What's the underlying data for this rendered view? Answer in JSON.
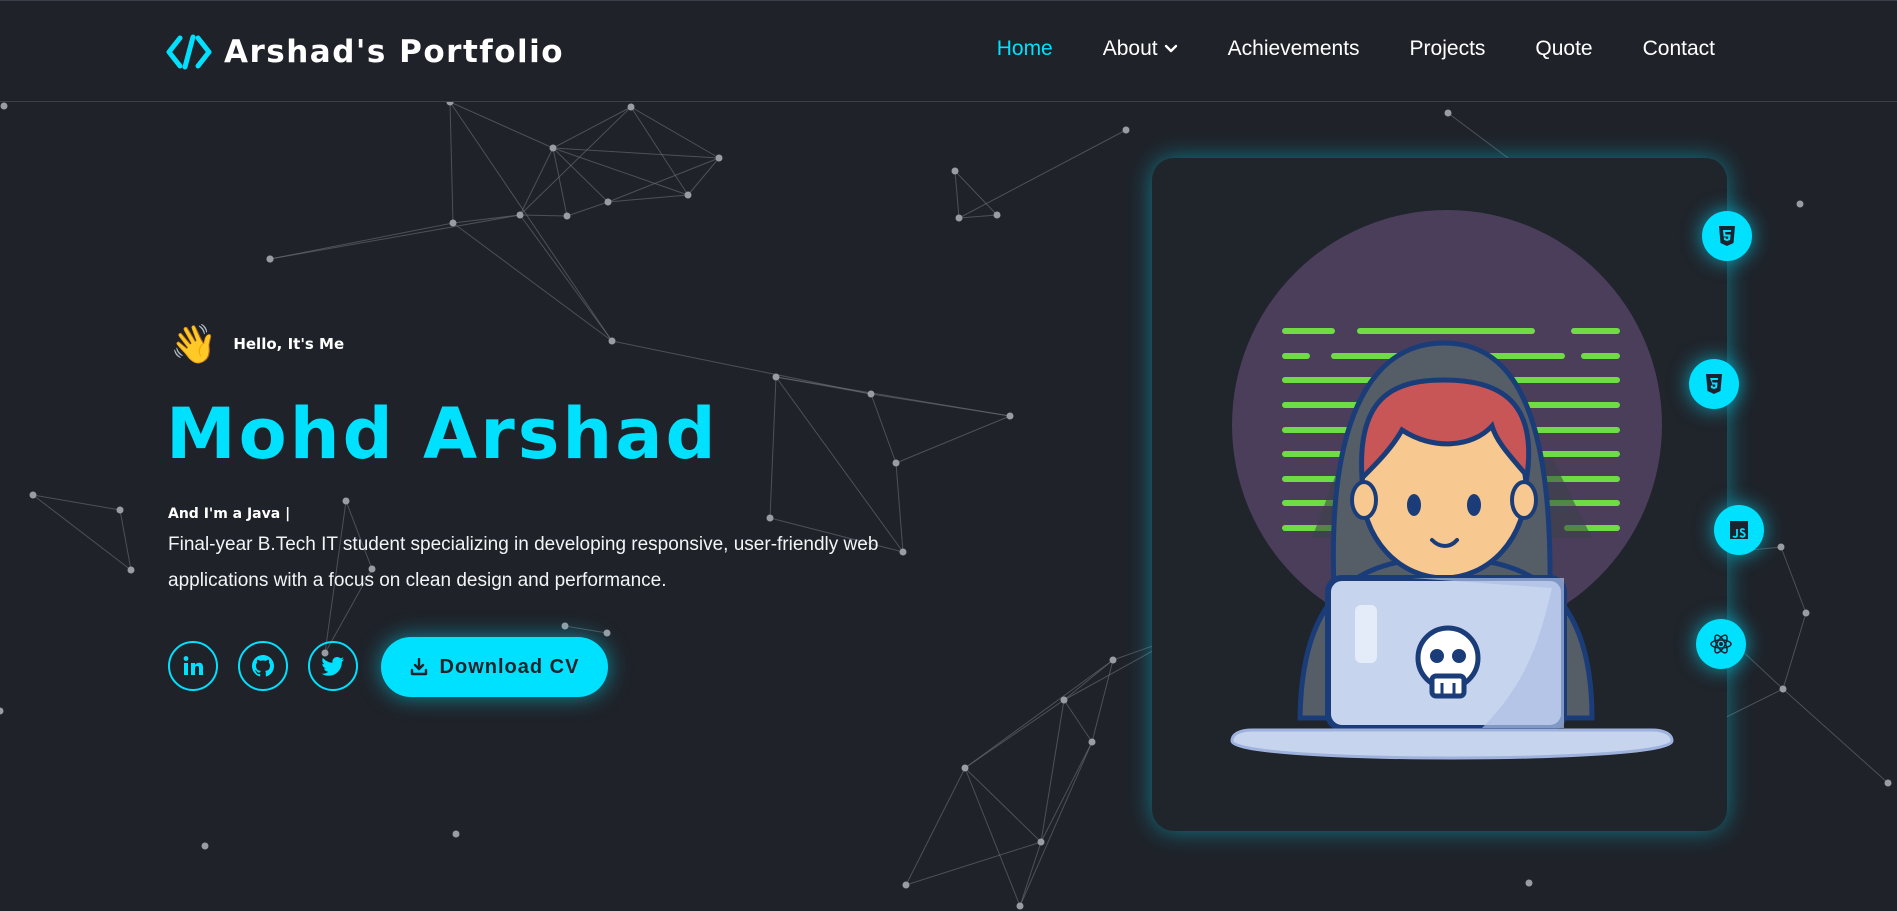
{
  "brand": {
    "name": "Arshad's Portfolio",
    "icon": "code-brackets-icon",
    "accent": "#00e1ff",
    "background": "#1f2229"
  },
  "nav": {
    "items": [
      {
        "label": "Home",
        "active": true
      },
      {
        "label": "About",
        "dropdown": true
      },
      {
        "label": "Achievements"
      },
      {
        "label": "Projects"
      },
      {
        "label": "Quote"
      },
      {
        "label": "Contact"
      }
    ]
  },
  "hero": {
    "greeting": "Hello, It's Me",
    "wave_emoji": "👋",
    "name": "Mohd Arshad",
    "role_prefix": "And I'm a Java |",
    "description": "Final-year B.Tech IT student specializing in developing responsive, user-friendly web applications with a focus on clean design and performance.",
    "socials": [
      {
        "icon": "linkedin-icon"
      },
      {
        "icon": "github-icon"
      },
      {
        "icon": "twitter-icon"
      }
    ],
    "cv_button": "Download CV"
  },
  "illustration": {
    "subject": "hooded-coder-with-laptop",
    "tech_badges": [
      "html5-icon",
      "css3-icon",
      "js-icon",
      "react-icon"
    ]
  }
}
